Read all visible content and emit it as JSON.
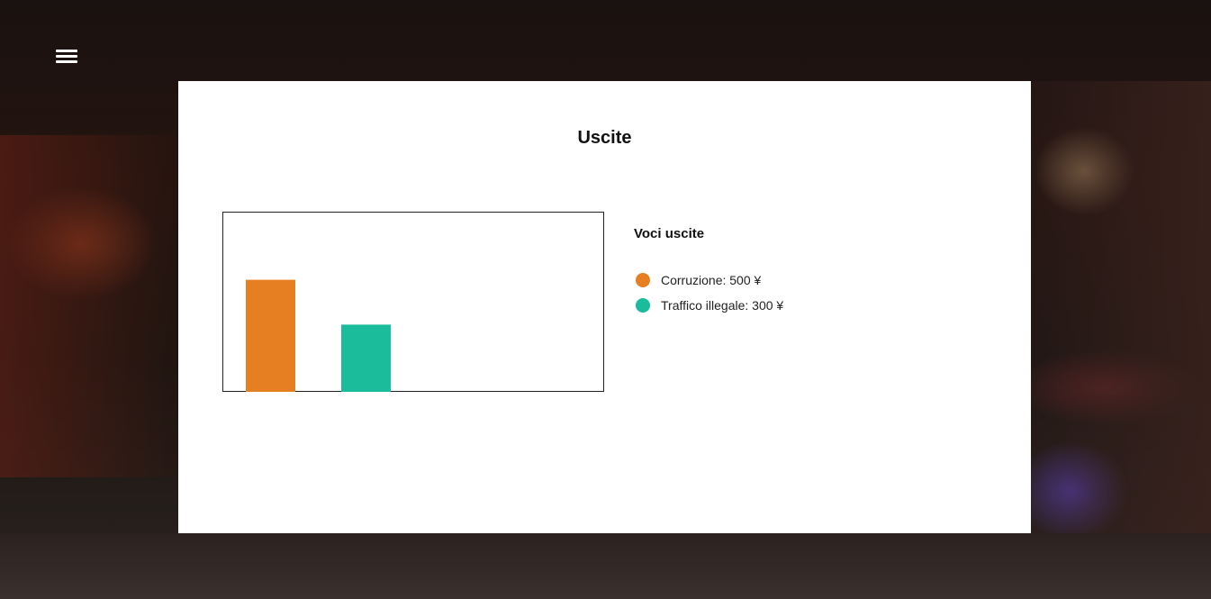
{
  "page": {
    "title": "Uscite"
  },
  "menu": {
    "icon": "hamburger-menu-icon"
  },
  "legend": {
    "title": "Voci uscite",
    "items": [
      {
        "label": "Corruzione: 500 ¥",
        "color": "#e67e22"
      },
      {
        "label": "Traffico illegale: 300 ¥",
        "color": "#1abc9c"
      }
    ]
  },
  "chart_data": {
    "type": "bar",
    "title": "",
    "xlabel": "",
    "ylabel": "",
    "categories": [
      "Corruzione",
      "Traffico illegale"
    ],
    "values": [
      500,
      300
    ],
    "colors": [
      "#e67e22",
      "#1abc9c"
    ],
    "ylim": [
      0,
      800
    ],
    "grid": false,
    "legend": "right"
  }
}
